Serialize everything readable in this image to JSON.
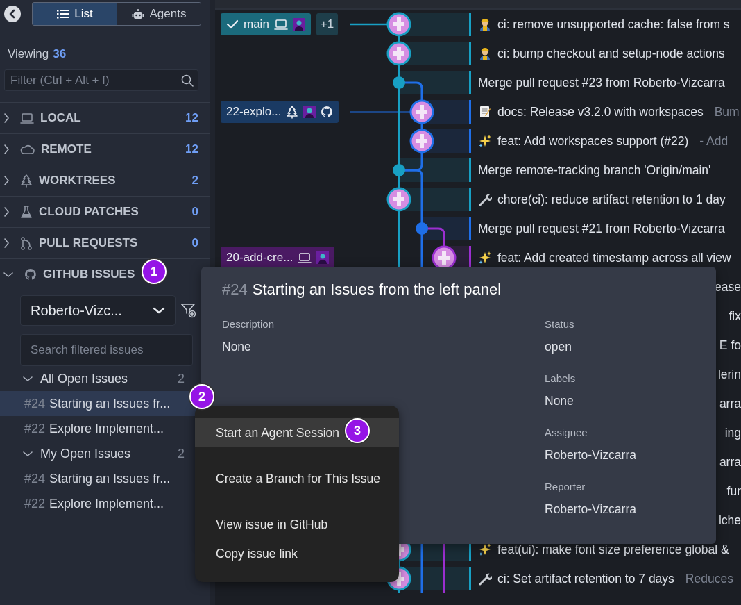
{
  "sidebar": {
    "view_tabs": [
      {
        "label": "List",
        "selected": true
      },
      {
        "label": "Agents",
        "selected": false
      }
    ],
    "viewing": {
      "label": "Viewing",
      "count": "36"
    },
    "filter": {
      "placeholder": "Filter (Ctrl + Alt + f)"
    },
    "sections": [
      {
        "kind": "local",
        "label": "LOCAL",
        "count": "12",
        "expanded": false
      },
      {
        "kind": "remote",
        "label": "REMOTE",
        "count": "12",
        "expanded": false
      },
      {
        "kind": "worktrees",
        "label": "WORKTREES",
        "count": "2",
        "expanded": false
      },
      {
        "kind": "cloud_patches",
        "label": "CLOUD PATCHES",
        "count": "0",
        "expanded": false
      },
      {
        "kind": "pull_requests",
        "label": "PULL REQUESTS",
        "count": "0",
        "expanded": false
      },
      {
        "kind": "github_issues",
        "label": "GITHUB ISSUES",
        "expanded": true,
        "callout": "1"
      }
    ],
    "issues_panel": {
      "account": "Roberto-Vizc...",
      "search": {
        "placeholder": "Search filtered issues"
      },
      "groups": [
        {
          "label": "All Open Issues",
          "count": "2",
          "expanded": true,
          "issues": [
            {
              "number": "#24",
              "title": "Starting an Issues fr...",
              "selected": true,
              "callout": "2"
            },
            {
              "number": "#22",
              "title": "Explore Implement...",
              "selected": false
            }
          ]
        },
        {
          "label": "My Open Issues",
          "count": "2",
          "expanded": true,
          "issues": [
            {
              "number": "#24",
              "title": "Starting an Issues fr...",
              "selected": false
            },
            {
              "number": "#22",
              "title": "Explore Implement...",
              "selected": false
            }
          ]
        }
      ]
    }
  },
  "commit_graph": {
    "rows": [
      {
        "ref": {
          "name": "main",
          "color": "#1b6a7c",
          "current": true,
          "local": true,
          "extra": "+1"
        },
        "color": "#18a0c4",
        "kind": "worker",
        "message": "ci: remove unsupported cache: false from s"
      },
      {
        "color": "#18a0c4",
        "kind": "worker",
        "message": "ci: bump checkout and setup-node actions"
      },
      {
        "color": "#18a0c4",
        "kind": "plain",
        "message": "Merge pull request #23 from Roberto-Vizcarra"
      },
      {
        "ref": {
          "name": "22-explo...",
          "color": "#1a3a63",
          "current": false,
          "worktree": true,
          "github": true
        },
        "color": "#1f6fe8",
        "kind": "memo",
        "message": "docs: Release v3.2.0 with workspaces",
        "description": "Bum"
      },
      {
        "color": "#1f6fe8",
        "kind": "sparkles",
        "message": "feat: Add workspaces support (#22)",
        "description": "- Add"
      },
      {
        "color": "#18a0c4",
        "kind": "plain",
        "message": "Merge remote-tracking branch 'Origin/main'"
      },
      {
        "color": "#18a0c4",
        "kind": "wrench",
        "message": "chore(ci): reduce artifact retention to 1 day"
      },
      {
        "color": "#1f6fe8",
        "kind": "plain",
        "message": "Merge pull request #21 from Roberto-Vizcarra"
      },
      {
        "ref": {
          "name": "20-add-cre...",
          "color": "#4a1a63",
          "current": false,
          "local": true
        },
        "color": "#9b2fd0",
        "kind": "sparkles",
        "message": "feat: Add created timestamp across all view"
      },
      {
        "message_fragment": "ease"
      },
      {
        "message_fragment": "fix"
      },
      {
        "message_fragment": "E fo"
      },
      {
        "message_fragment": "lerin"
      },
      {
        "message_fragment": "arra"
      },
      {
        "message_fragment": "ing"
      },
      {
        "message_fragment": "arra"
      },
      {
        "message_fragment": "fur"
      },
      {
        "message_fragment": "lche"
      },
      {
        "color": "#18a0c4",
        "kind": "sparkles",
        "message": "feat(ui): make font size preference global &"
      },
      {
        "color": "#18a0c4",
        "kind": "wrench",
        "message": "ci: Set artifact retention to 7 days",
        "description": "Reduces"
      }
    ]
  },
  "issue_popover": {
    "number": "#24",
    "title": "Starting an Issues from the left panel",
    "left_fields": [
      {
        "label": "Description",
        "value": "None"
      }
    ],
    "right_fields": [
      {
        "label": "Status",
        "value": "open"
      },
      {
        "label": "Labels",
        "value": "None"
      },
      {
        "label": "Assignee",
        "value": "Roberto-Vizcarra"
      },
      {
        "label": "Reporter",
        "value": "Roberto-Vizcarra"
      }
    ]
  },
  "context_menu": {
    "groups": [
      [
        {
          "label": "Start an Agent Session",
          "selected": true,
          "callout": "3"
        }
      ],
      [
        {
          "label": "Create a Branch for This Issue",
          "selected": false
        }
      ],
      [
        {
          "label": "View issue in GitHub",
          "selected": false
        },
        {
          "label": "Copy issue link",
          "selected": false
        }
      ]
    ]
  }
}
